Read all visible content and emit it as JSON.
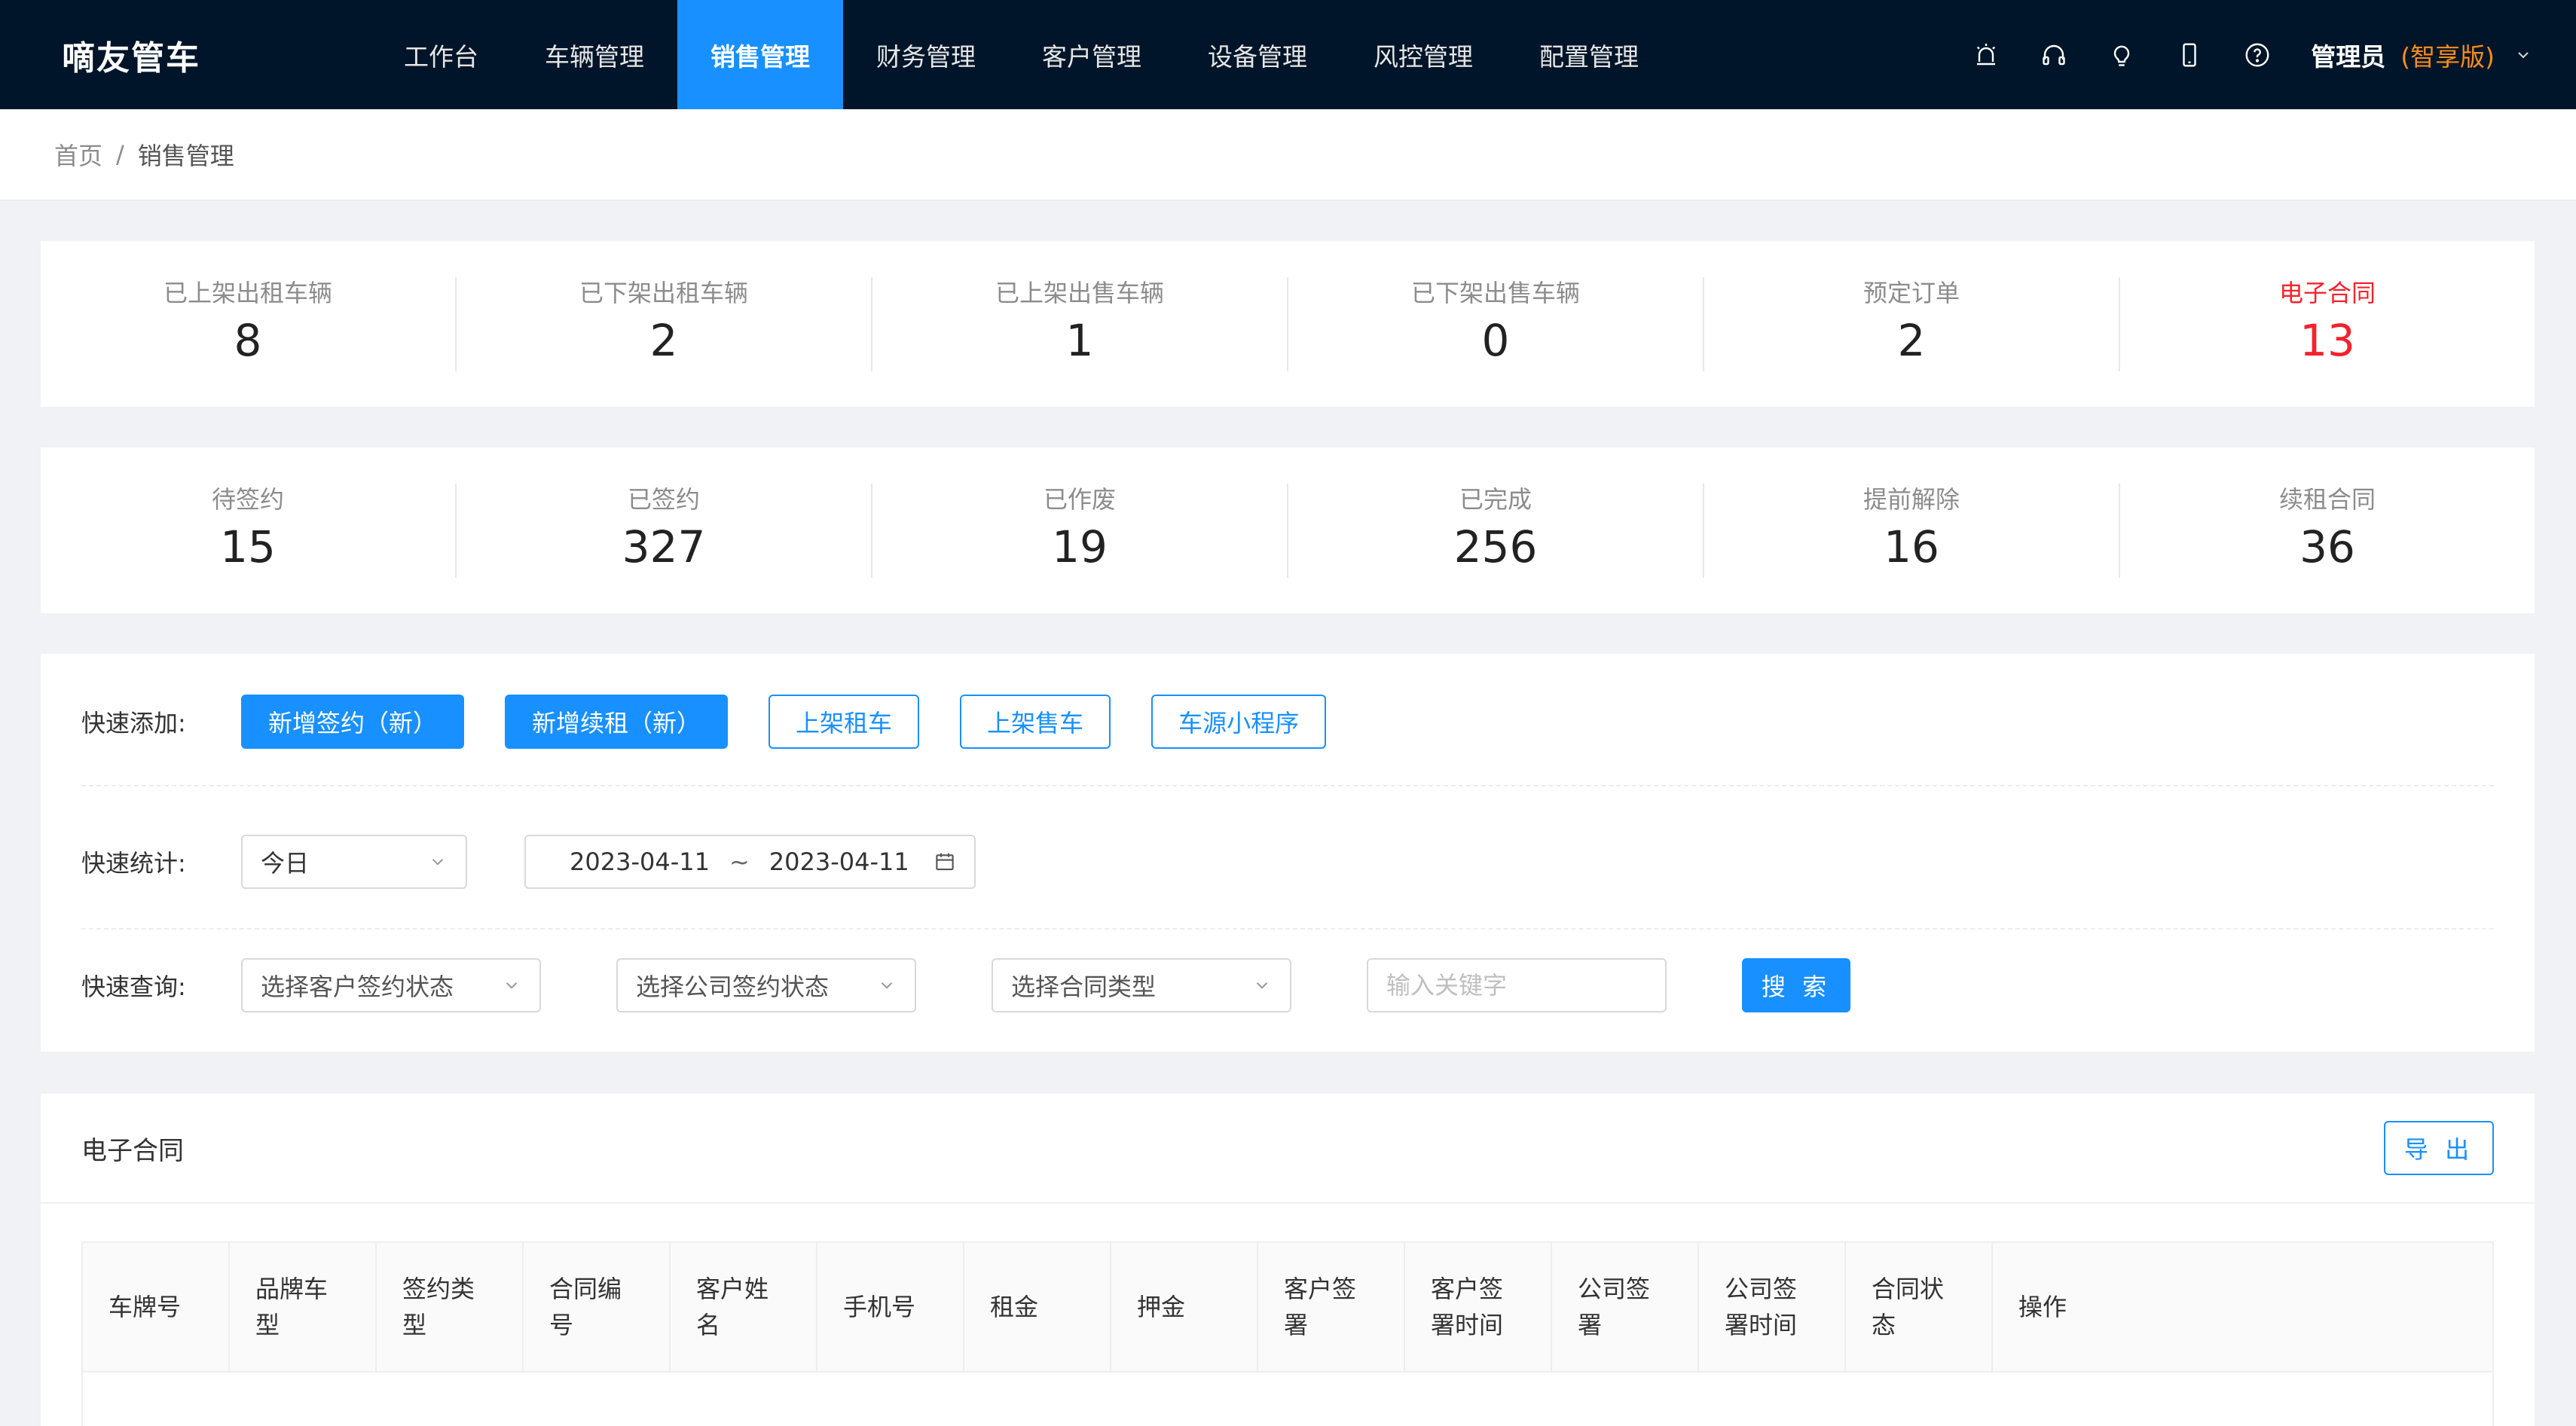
{
  "header": {
    "brand": "嘀友管车",
    "nav": [
      {
        "label": "工作台"
      },
      {
        "label": "车辆管理"
      },
      {
        "label": "销售管理"
      },
      {
        "label": "财务管理"
      },
      {
        "label": "客户管理"
      },
      {
        "label": "设备管理"
      },
      {
        "label": "风控管理"
      },
      {
        "label": "配置管理"
      }
    ],
    "active_nav": "销售管理",
    "icons": [
      "alarm-icon",
      "headset-icon",
      "bulb-icon",
      "phone-icon",
      "help-icon"
    ],
    "user": {
      "name": "管理员",
      "edition": "(智享版)"
    }
  },
  "breadcrumb": {
    "home": "首页",
    "separator": "/",
    "current": "销售管理"
  },
  "stats_row1": [
    {
      "label": "已上架出租车辆",
      "value": "8"
    },
    {
      "label": "已下架出租车辆",
      "value": "2"
    },
    {
      "label": "已上架出售车辆",
      "value": "1"
    },
    {
      "label": "已下架出售车辆",
      "value": "0"
    },
    {
      "label": "预定订单",
      "value": "2"
    },
    {
      "label": "电子合同",
      "value": "13"
    }
  ],
  "stats_row2": [
    {
      "label": "待签约",
      "value": "15"
    },
    {
      "label": "已签约",
      "value": "327"
    },
    {
      "label": "已作废",
      "value": "19"
    },
    {
      "label": "已完成",
      "value": "256"
    },
    {
      "label": "提前解除",
      "value": "16"
    },
    {
      "label": "续租合同",
      "value": "36"
    }
  ],
  "quick_add": {
    "label": "快速添加:",
    "buttons": [
      "新增签约（新）",
      "新增续租（新）",
      "上架租车",
      "上架售车",
      "车源小程序"
    ]
  },
  "quick_stats": {
    "label": "快速统计:",
    "period": "今日",
    "date_start": "2023-04-11",
    "date_sep": "~",
    "date_end": "2023-04-11"
  },
  "quick_query": {
    "label": "快速查询:",
    "customer_status_placeholder": "选择客户签约状态",
    "company_status_placeholder": "选择公司签约状态",
    "contract_type_placeholder": "选择合同类型",
    "keyword_placeholder": "输入关键字",
    "search_label": "搜 索"
  },
  "contract": {
    "title": "电子合同",
    "export_label": "导 出",
    "columns": [
      "车牌号",
      "品牌车型",
      "签约类型",
      "合同编号",
      "客户姓名",
      "手机号",
      "租金",
      "押金",
      "客户签署",
      "客户签署时间",
      "公司签署",
      "公司签署时间",
      "合同状态",
      "操作"
    ]
  },
  "colors": {
    "nav_bg": "#001529",
    "accent": "#1890ff",
    "highlight": "#f5222d",
    "edition": "#fa8c16"
  }
}
